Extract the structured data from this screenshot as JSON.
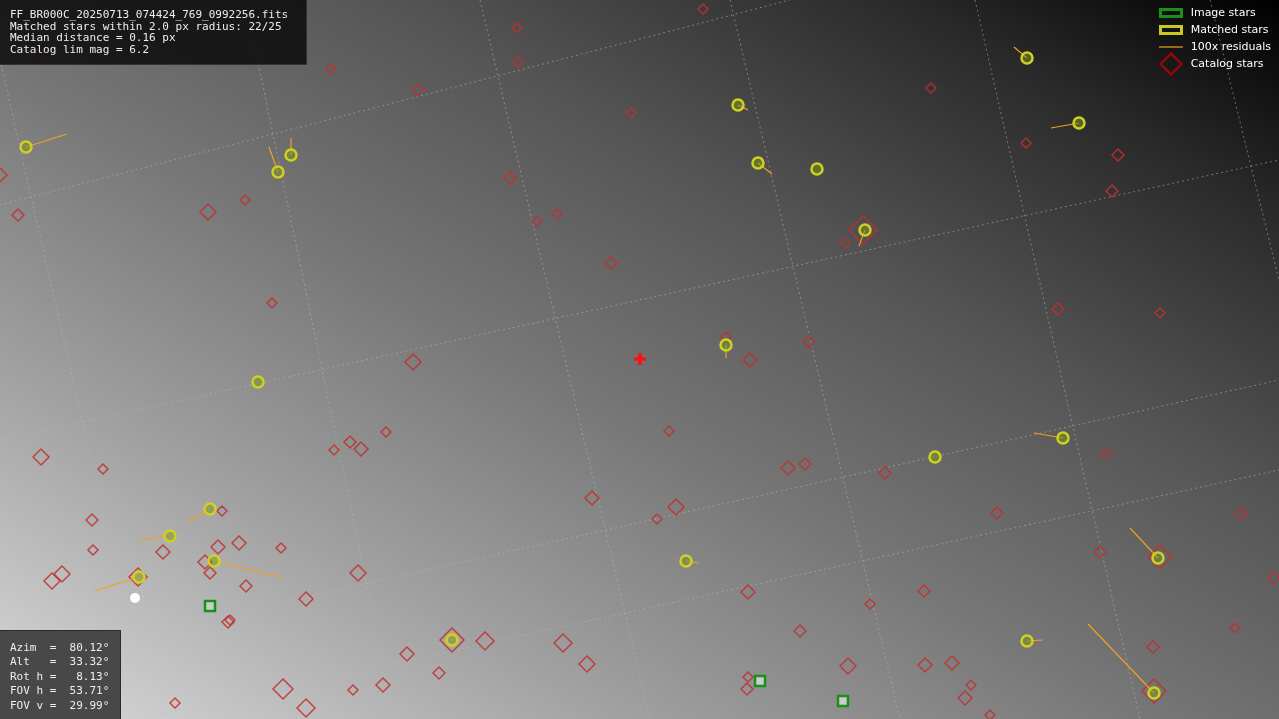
{
  "info_panel": {
    "lines": [
      "FF_BR000C_20250713_074424_769_0992256.fits",
      "Matched stars within 2.0 px radius: 22/25",
      "Median distance = 0.16 px",
      "Catalog lim mag = 6.2"
    ]
  },
  "legend": [
    {
      "kind": "image",
      "label": "Image stars"
    },
    {
      "kind": "matched",
      "label": "Matched stars"
    },
    {
      "kind": "residual",
      "label": "100x residuals"
    },
    {
      "kind": "catalog",
      "label": "Catalog stars"
    }
  ],
  "pointing_panel": {
    "lines": [
      "Azim  =  80.12°",
      "Alt   =  33.32°",
      "Rot h =   8.13°",
      "FOV h =  53.71°",
      "FOV v =  29.99°"
    ]
  }
}
